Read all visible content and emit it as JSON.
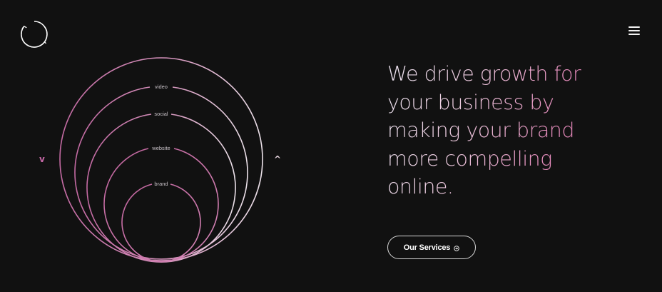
{
  "header": {
    "logo_icon": "circular-arrows-logo-icon",
    "menu_icon": "hamburger-menu-icon"
  },
  "diagram": {
    "rings": [
      {
        "label": "video"
      },
      {
        "label": "social"
      },
      {
        "label": "website"
      },
      {
        "label": "brand"
      }
    ],
    "prev_icon": "chevron-down-icon",
    "next_icon": "chevron-up-icon",
    "prev_label": "v",
    "next_label": "^",
    "colors": {
      "outer_ring": "#e8dde6",
      "inner_ring": "#c46aa3"
    }
  },
  "hero": {
    "headline_lines": [
      "We drive growth for",
      "your business by",
      "making your brand",
      "more compelling",
      "online."
    ],
    "cta_label": "Our Services",
    "cta_icon": "arrow-circle-right-icon"
  },
  "colors": {
    "background": "#111111",
    "text": "#ffffff",
    "accent_pink": "#e07ab1",
    "accent_light": "#ece4f0"
  }
}
